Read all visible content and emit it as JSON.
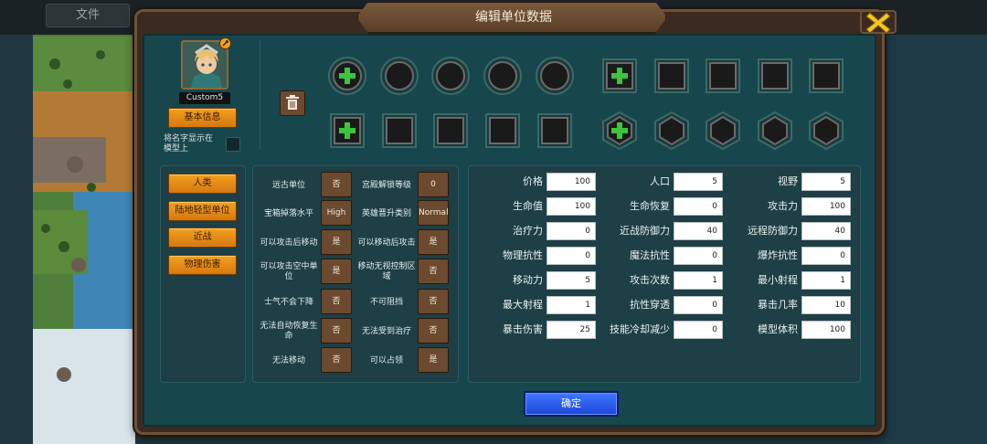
{
  "topbar": {
    "file_label": "文件"
  },
  "dialog": {
    "title": "编辑单位数据"
  },
  "unit": {
    "name": "Custom5",
    "basic_info_label": "基本信息",
    "show_name_label_line1": "将名字显示在",
    "show_name_label_line2": "模型上"
  },
  "categories": [
    "人类",
    "陆地轻型单位",
    "近战",
    "物理伤害"
  ],
  "properties": [
    {
      "left_label": "远古单位",
      "left_value": "否",
      "right_label": "宫殿解锁等级",
      "right_value": "0"
    },
    {
      "left_label": "宝箱掉落水平",
      "left_value": "High",
      "right_label": "英雄晋升类别",
      "right_value": "Normal"
    },
    {
      "left_label": "可以攻击后移动",
      "left_value": "是",
      "right_label": "可以移动后攻击",
      "right_value": "是"
    },
    {
      "left_label": "可以攻击空中单位",
      "left_value": "是",
      "right_label": "移动无视控制区域",
      "right_value": "否"
    },
    {
      "left_label": "士气不会下降",
      "left_value": "否",
      "right_label": "不可阻挡",
      "right_value": "否"
    },
    {
      "left_label": "无法自动恢复生命",
      "left_value": "否",
      "right_label": "无法受到治疗",
      "right_value": "否"
    },
    {
      "left_label": "无法移动",
      "left_value": "否",
      "right_label": "可以占领",
      "right_value": "是"
    }
  ],
  "stats": [
    [
      {
        "label": "价格",
        "value": "100"
      },
      {
        "label": "人口",
        "value": "5"
      },
      {
        "label": "视野",
        "value": "5"
      }
    ],
    [
      {
        "label": "生命值",
        "value": "100"
      },
      {
        "label": "生命恢复",
        "value": "0"
      },
      {
        "label": "攻击力",
        "value": "100"
      }
    ],
    [
      {
        "label": "治疗力",
        "value": "0"
      },
      {
        "label": "近战防御力",
        "value": "40"
      },
      {
        "label": "远程防御力",
        "value": "40"
      }
    ],
    [
      {
        "label": "物理抗性",
        "value": "0"
      },
      {
        "label": "魔法抗性",
        "value": "0"
      },
      {
        "label": "爆炸抗性",
        "value": "0"
      }
    ],
    [
      {
        "label": "移动力",
        "value": "5"
      },
      {
        "label": "攻击次数",
        "value": "1"
      },
      {
        "label": "最小射程",
        "value": "1"
      }
    ],
    [
      {
        "label": "最大射程",
        "value": "1"
      },
      {
        "label": "抗性穿透",
        "value": "0"
      },
      {
        "label": "暴击几率",
        "value": "10"
      }
    ],
    [
      {
        "label": "暴击伤害",
        "value": "25"
      },
      {
        "label": "技能冷却减少",
        "value": "0"
      },
      {
        "label": "模型体积",
        "value": "100"
      }
    ]
  ],
  "confirm_label": "确定",
  "colors": {
    "accent_orange": "#f2a020",
    "confirm_blue": "#2e5ef0",
    "panel": "#17474d",
    "add_green": "#3cc43c"
  }
}
